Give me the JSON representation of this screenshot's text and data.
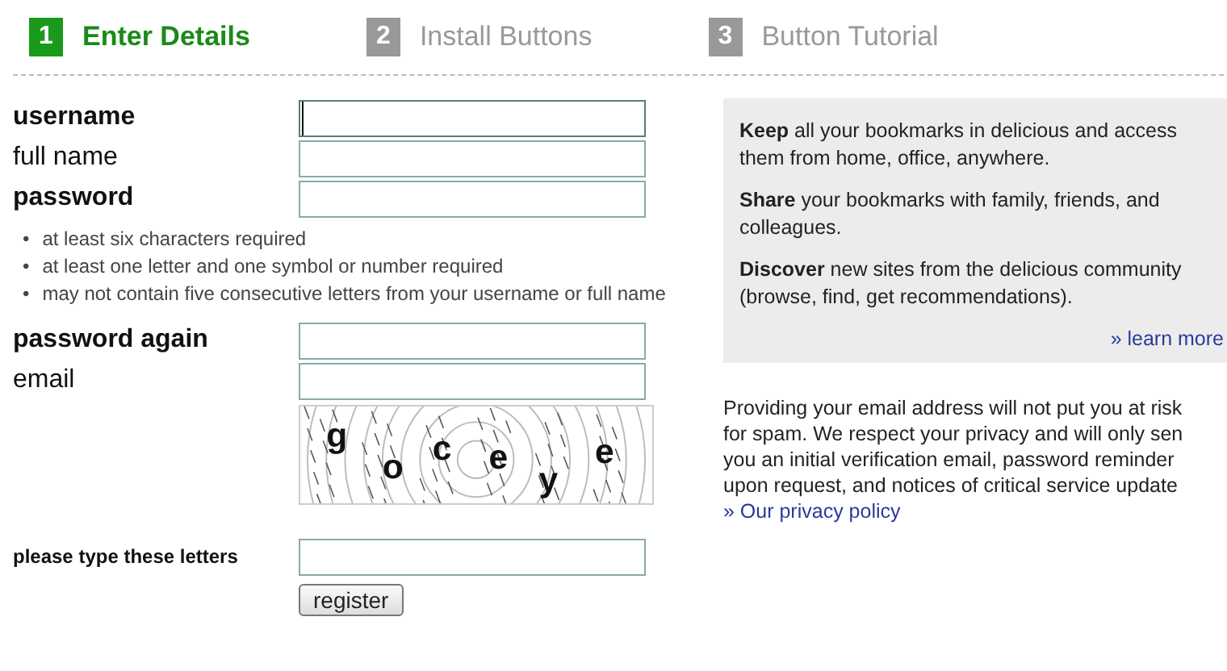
{
  "steps": [
    {
      "number": "1",
      "label": "Enter Details",
      "selected": true
    },
    {
      "number": "2",
      "label": "Install Buttons",
      "selected": false
    },
    {
      "number": "3",
      "label": "Button Tutorial",
      "selected": false
    }
  ],
  "form": {
    "fields": [
      {
        "label": "username",
        "bold": true,
        "focused": true
      },
      {
        "label": "full name",
        "bold": false,
        "focused": false
      },
      {
        "label": "password",
        "bold": true,
        "focused": false,
        "bullet": "•",
        "rules": [
          "at least six characters required",
          "at least one letter and one symbol or number required",
          "may not contain five consecutive letters from your username or full name"
        ]
      },
      {
        "label": "password again",
        "bold": true,
        "focused": false
      },
      {
        "label": "email",
        "bold": false,
        "focused": false
      }
    ],
    "captcha": {
      "letters": [
        "g",
        "o",
        "c",
        "e",
        "y",
        "e"
      ]
    },
    "captcha_label": "please type these letters",
    "submit": "register"
  },
  "info_box": {
    "paragraphs": [
      "**Keep** all your bookmarks in delicious and access them from home, office, anywhere.",
      "**Share** your bookmarks with family, friends, and colleagues.",
      "**Discover** new sites from the delicious community (browse, find, get recommendations)."
    ],
    "link": "» learn more"
  },
  "privacy": {
    "lines": [
      "Providing your email address will not put you at risk",
      "for spam. We respect your privacy and will only sen",
      "you an initial verification email, password reminder",
      "upon request, and notices of critical service update"
    ],
    "link": "» Our privacy policy"
  }
}
